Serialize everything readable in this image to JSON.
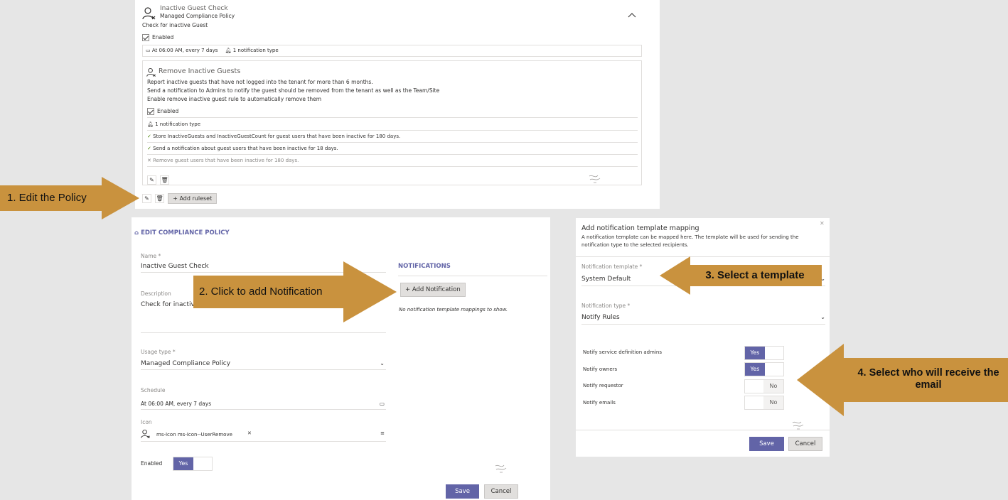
{
  "policy_card": {
    "title": "Inactive Guest Check",
    "subtitle": "Managed Compliance Policy",
    "description": "Check for inactive Guest",
    "enabled_label": "Enabled",
    "schedule": "At 06:00 AM, every 7 days",
    "notification_count": "1 notification type",
    "ruleset": {
      "title": "Remove Inactive Guests",
      "desc_lines": [
        "Report inactive guests that have not logged into the tenant for more than 6 months.",
        "Send a notification to Admins to notify the guest should be removed from the tenant as well as the Team/Site",
        "Enable remove inactive guest rule to automatically remove them"
      ],
      "enabled_label": "Enabled",
      "notification_count": "1 notification type",
      "rules": [
        {
          "status": "check",
          "text": "Store InactiveGuests and InactiveGuestCount for guest users that have been inactive for 180 days."
        },
        {
          "status": "check",
          "text": "Send a notification about guest users that have been inactive for 18 days."
        },
        {
          "status": "x",
          "text": "Remove guest users that have been inactive for 180 days."
        }
      ]
    },
    "add_ruleset_label": "Add ruleset"
  },
  "edit_form": {
    "heading": "EDIT COMPLIANCE POLICY",
    "name_label": "Name *",
    "name_value": "Inactive Guest Check",
    "description_label": "Description",
    "description_value": "Check for inactive",
    "usage_label": "Usage type *",
    "usage_value": "Managed Compliance Policy",
    "schedule_label": "Schedule",
    "schedule_value": "At 06:00 AM, every 7 days",
    "icon_label": "Icon",
    "icon_value": "ms-Icon ms-Icon--UserRemove",
    "enabled_label": "Enabled",
    "enabled_toggle": "Yes",
    "notifications_heading": "NOTIFICATIONS",
    "add_notification_label": "Add Notification",
    "no_mappings": "No notification template mappings to show.",
    "save_label": "Save",
    "cancel_label": "Cancel"
  },
  "dialog": {
    "title": "Add notification template mapping",
    "description": "A notification template can be mapped here. The template will be used for sending the notification type to the selected recipients.",
    "template_label": "Notification template *",
    "template_value": "System Default",
    "type_label": "Notification type *",
    "type_value": "Notify Rules",
    "options": [
      {
        "label": "Notify service definition admins",
        "toggle": "Yes",
        "on": true
      },
      {
        "label": "Notify owners",
        "toggle": "Yes",
        "on": true
      },
      {
        "label": "Notify requestor",
        "toggle": "No",
        "on": false
      },
      {
        "label": "Notify emails",
        "toggle": "No",
        "on": false
      }
    ],
    "save_label": "Save",
    "cancel_label": "Cancel"
  },
  "callouts": {
    "step1": "1. Edit the Policy",
    "step2": "2. Click to add Notification",
    "step3": "3. Select a template",
    "step4": "4. Select who will receive the email"
  },
  "colors": {
    "accent": "#6264a7",
    "callout": "#c9923e",
    "background": "#e6e6e6"
  }
}
